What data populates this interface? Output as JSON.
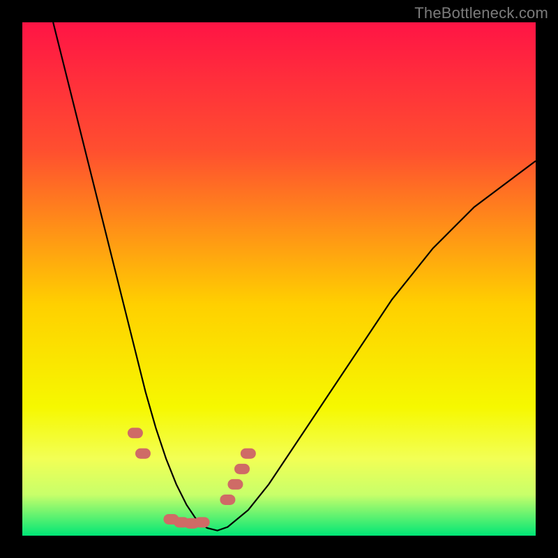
{
  "watermark": "TheBottleneck.com",
  "chart_data": {
    "type": "line",
    "title": "",
    "xlabel": "",
    "ylabel": "",
    "xlim": [
      0,
      100
    ],
    "ylim": [
      0,
      100
    ],
    "series": [
      {
        "name": "bottleneck-curve",
        "x": [
          6,
          8,
          10,
          12,
          14,
          16,
          18,
          20,
          22,
          24,
          26,
          28,
          30,
          32,
          34,
          36,
          38,
          40,
          44,
          48,
          52,
          56,
          60,
          64,
          68,
          72,
          76,
          80,
          84,
          88,
          92,
          96,
          100
        ],
        "y": [
          100,
          92,
          84,
          76,
          68,
          60,
          52,
          44,
          36,
          28,
          21,
          15,
          10,
          6,
          3,
          1.5,
          1,
          1.7,
          5,
          10,
          16,
          22,
          28,
          34,
          40,
          46,
          51,
          56,
          60,
          64,
          67,
          70,
          73
        ]
      }
    ],
    "markers": [
      {
        "x": 22,
        "y": 20
      },
      {
        "x": 23.5,
        "y": 16
      },
      {
        "x": 29,
        "y": 3.2
      },
      {
        "x": 31,
        "y": 2.6
      },
      {
        "x": 33,
        "y": 2.4
      },
      {
        "x": 35,
        "y": 2.6
      },
      {
        "x": 40,
        "y": 7
      },
      {
        "x": 41.5,
        "y": 10
      },
      {
        "x": 42.8,
        "y": 13
      },
      {
        "x": 44,
        "y": 16
      }
    ],
    "gradient_stops": [
      {
        "pct": 0,
        "color": "#ff1445"
      },
      {
        "pct": 25,
        "color": "#ff4f2f"
      },
      {
        "pct": 55,
        "color": "#ffd000"
      },
      {
        "pct": 75,
        "color": "#f6f800"
      },
      {
        "pct": 85,
        "color": "#f2ff55"
      },
      {
        "pct": 92,
        "color": "#c8ff6a"
      },
      {
        "pct": 100,
        "color": "#00e676"
      }
    ]
  }
}
